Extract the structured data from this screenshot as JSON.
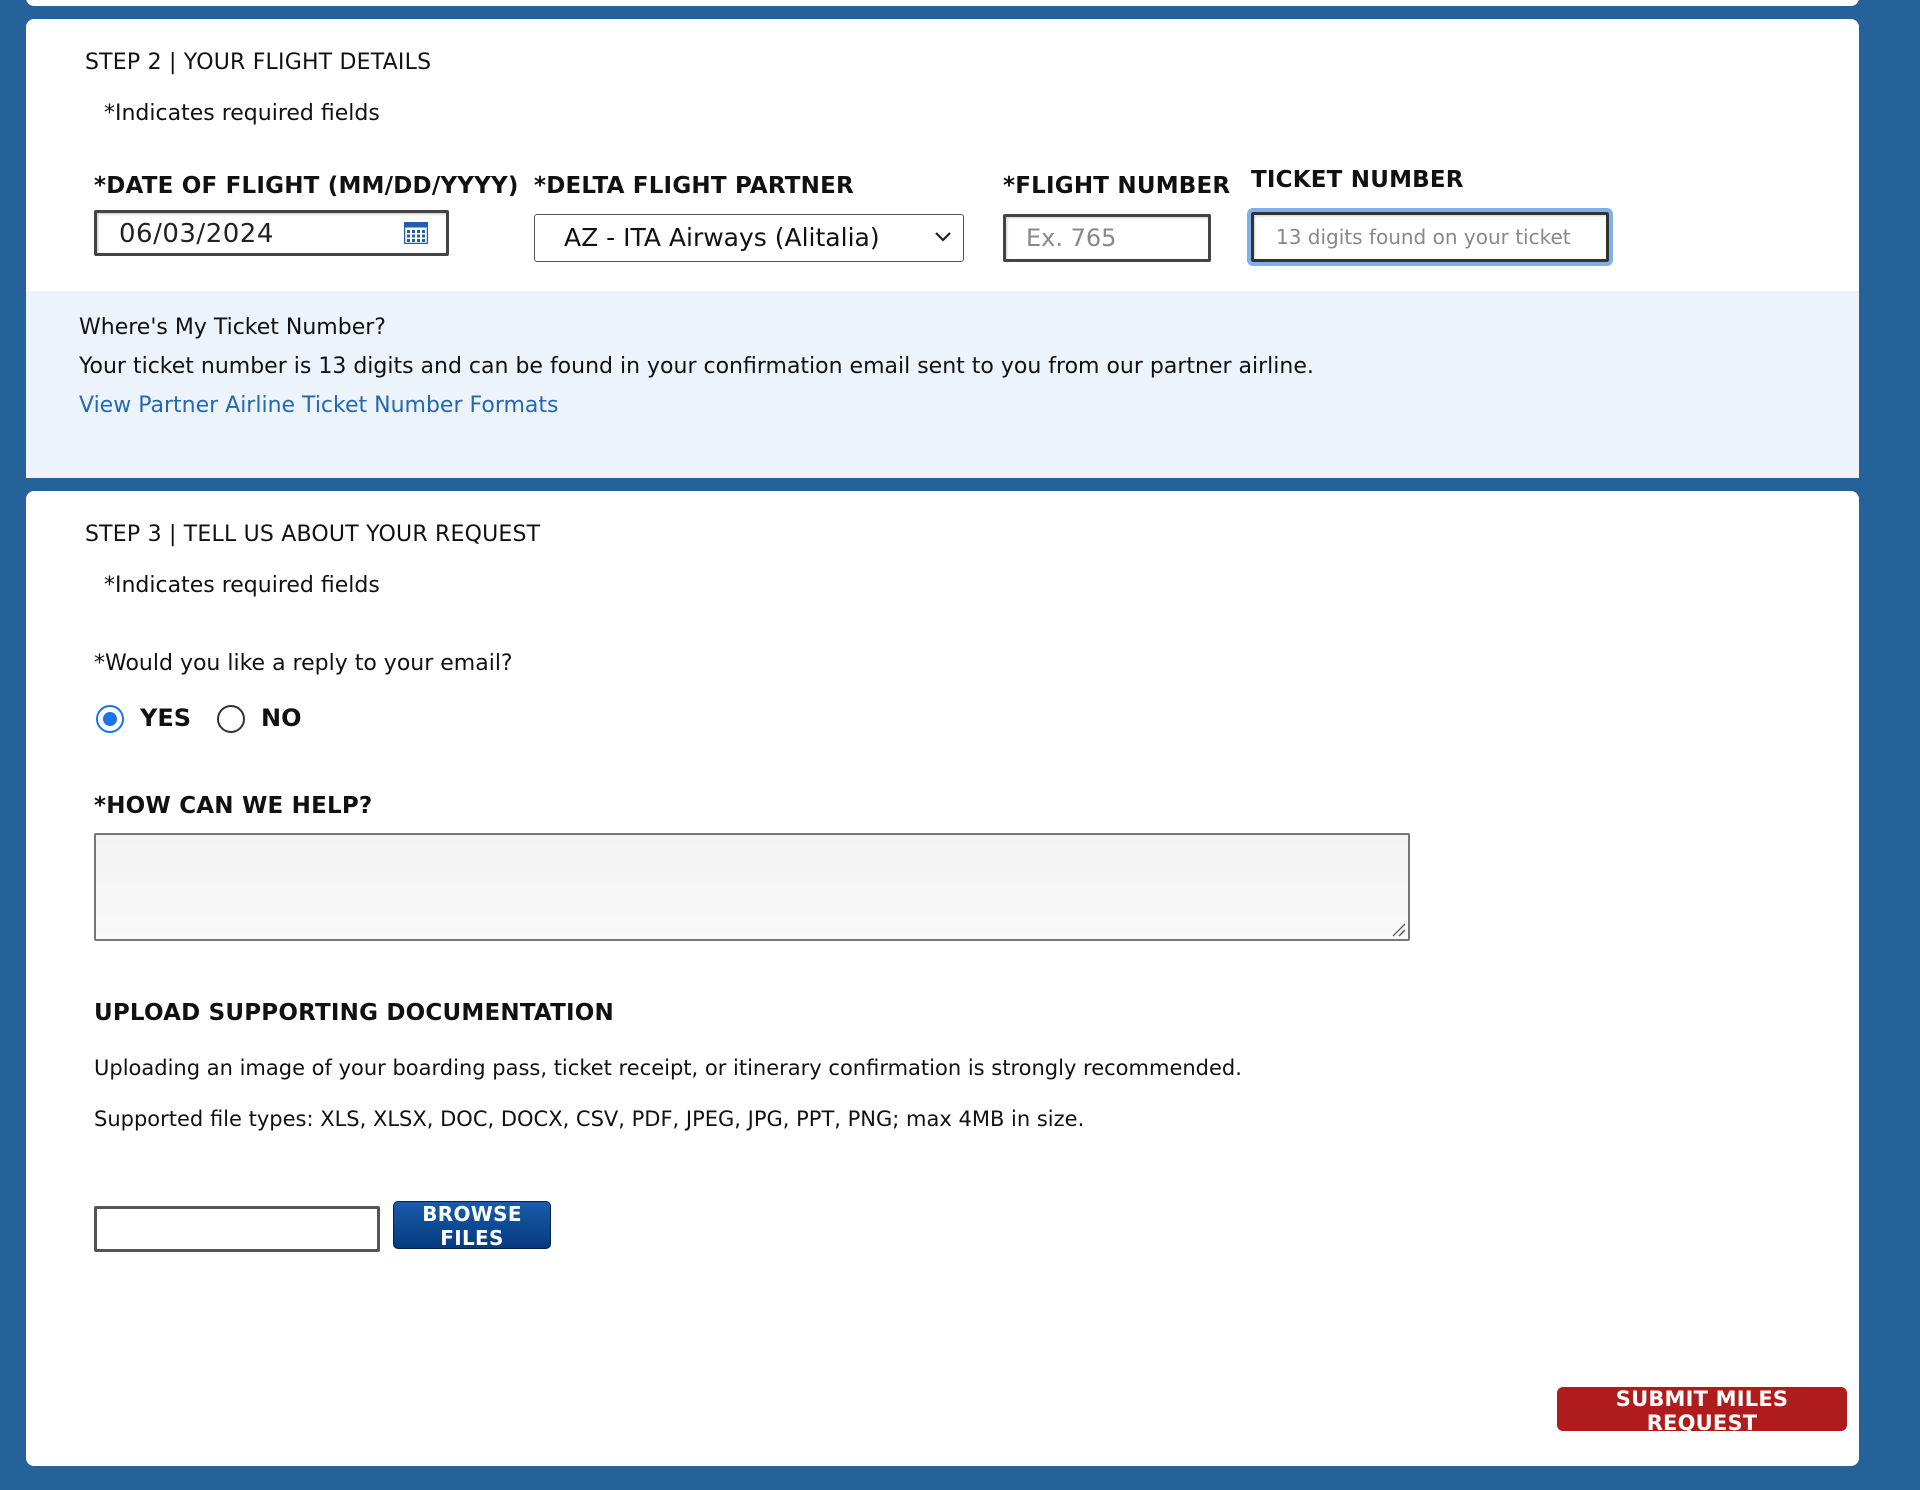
{
  "step2": {
    "title": "STEP 2 | YOUR FLIGHT DETAILS",
    "required_note": "*Indicates required fields",
    "date_label": "*DATE OF FLIGHT (MM/DD/YYYY)",
    "date_value": "06/03/2024",
    "partner_label": "*DELTA FLIGHT PARTNER",
    "partner_value": "AZ - ITA Airways (Alitalia)",
    "flight_number_label": "*FLIGHT NUMBER",
    "flight_number_placeholder": "Ex. 765",
    "ticket_number_label": "TICKET NUMBER",
    "ticket_number_placeholder": "13 digits found on your ticket",
    "info": {
      "title": "Where's My Ticket Number?",
      "text": "Your ticket number is 13 digits and can be found in your confirmation email sent to you from our partner airline.",
      "link": "View Partner Airline Ticket Number Formats"
    }
  },
  "step3": {
    "title": "STEP 3 | TELL US ABOUT YOUR REQUEST",
    "required_note": "*Indicates required fields",
    "reply_question": "*Would you like a reply to your email?",
    "reply_options": [
      {
        "label": "YES",
        "selected": true
      },
      {
        "label": "NO",
        "selected": false
      }
    ],
    "help_label": "*HOW CAN WE HELP?",
    "upload": {
      "title": "UPLOAD SUPPORTING DOCUMENTATION",
      "text1": "Uploading an image of your boarding pass, ticket receipt, or itinerary confirmation is strongly recommended.",
      "text2": "Supported file types: XLS, XLSX, DOC, DOCX, CSV, PDF, JPEG, JPG, PPT, PNG; max 4MB in size.",
      "browse_label": "BROWSE FILES"
    },
    "submit_label": "SUBMIT MILES REQUEST"
  },
  "colors": {
    "background": "#246299",
    "info_band": "#edf3fa",
    "link": "#2468b3",
    "radio_selected": "#1a73e8",
    "browse_button": "#063a7e",
    "submit_button": "#b01c1c",
    "focus_outline": "#7fb0e8"
  },
  "icons": {
    "date_picker": "calendar-icon",
    "select": "chevron-down-icon",
    "textarea": "resize-handle-icon"
  }
}
